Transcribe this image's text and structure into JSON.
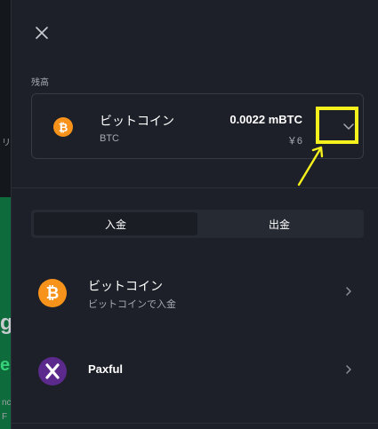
{
  "balance": {
    "label": "残高",
    "coin_name": "ビットコイン",
    "coin_symbol": "BTC",
    "amount": "0.0022 mBTC",
    "fiat_value": "￥6"
  },
  "tabs": [
    {
      "label": "入金",
      "active": true
    },
    {
      "label": "出金",
      "active": false
    }
  ],
  "methods": [
    {
      "name": "ビットコイン",
      "subtitle": "ビットコインで入金",
      "icon": "bitcoin-icon"
    },
    {
      "name": "Paxful",
      "subtitle": "",
      "icon": "paxful-icon"
    }
  ],
  "background_fragments": [
    "リ",
    "g",
    "e",
    "nc",
    "F"
  ],
  "colors": {
    "bitcoin": "#f7931a",
    "paxful": "#5b2a8c",
    "highlight": "#f6f01c",
    "panel": "#1d2028"
  }
}
